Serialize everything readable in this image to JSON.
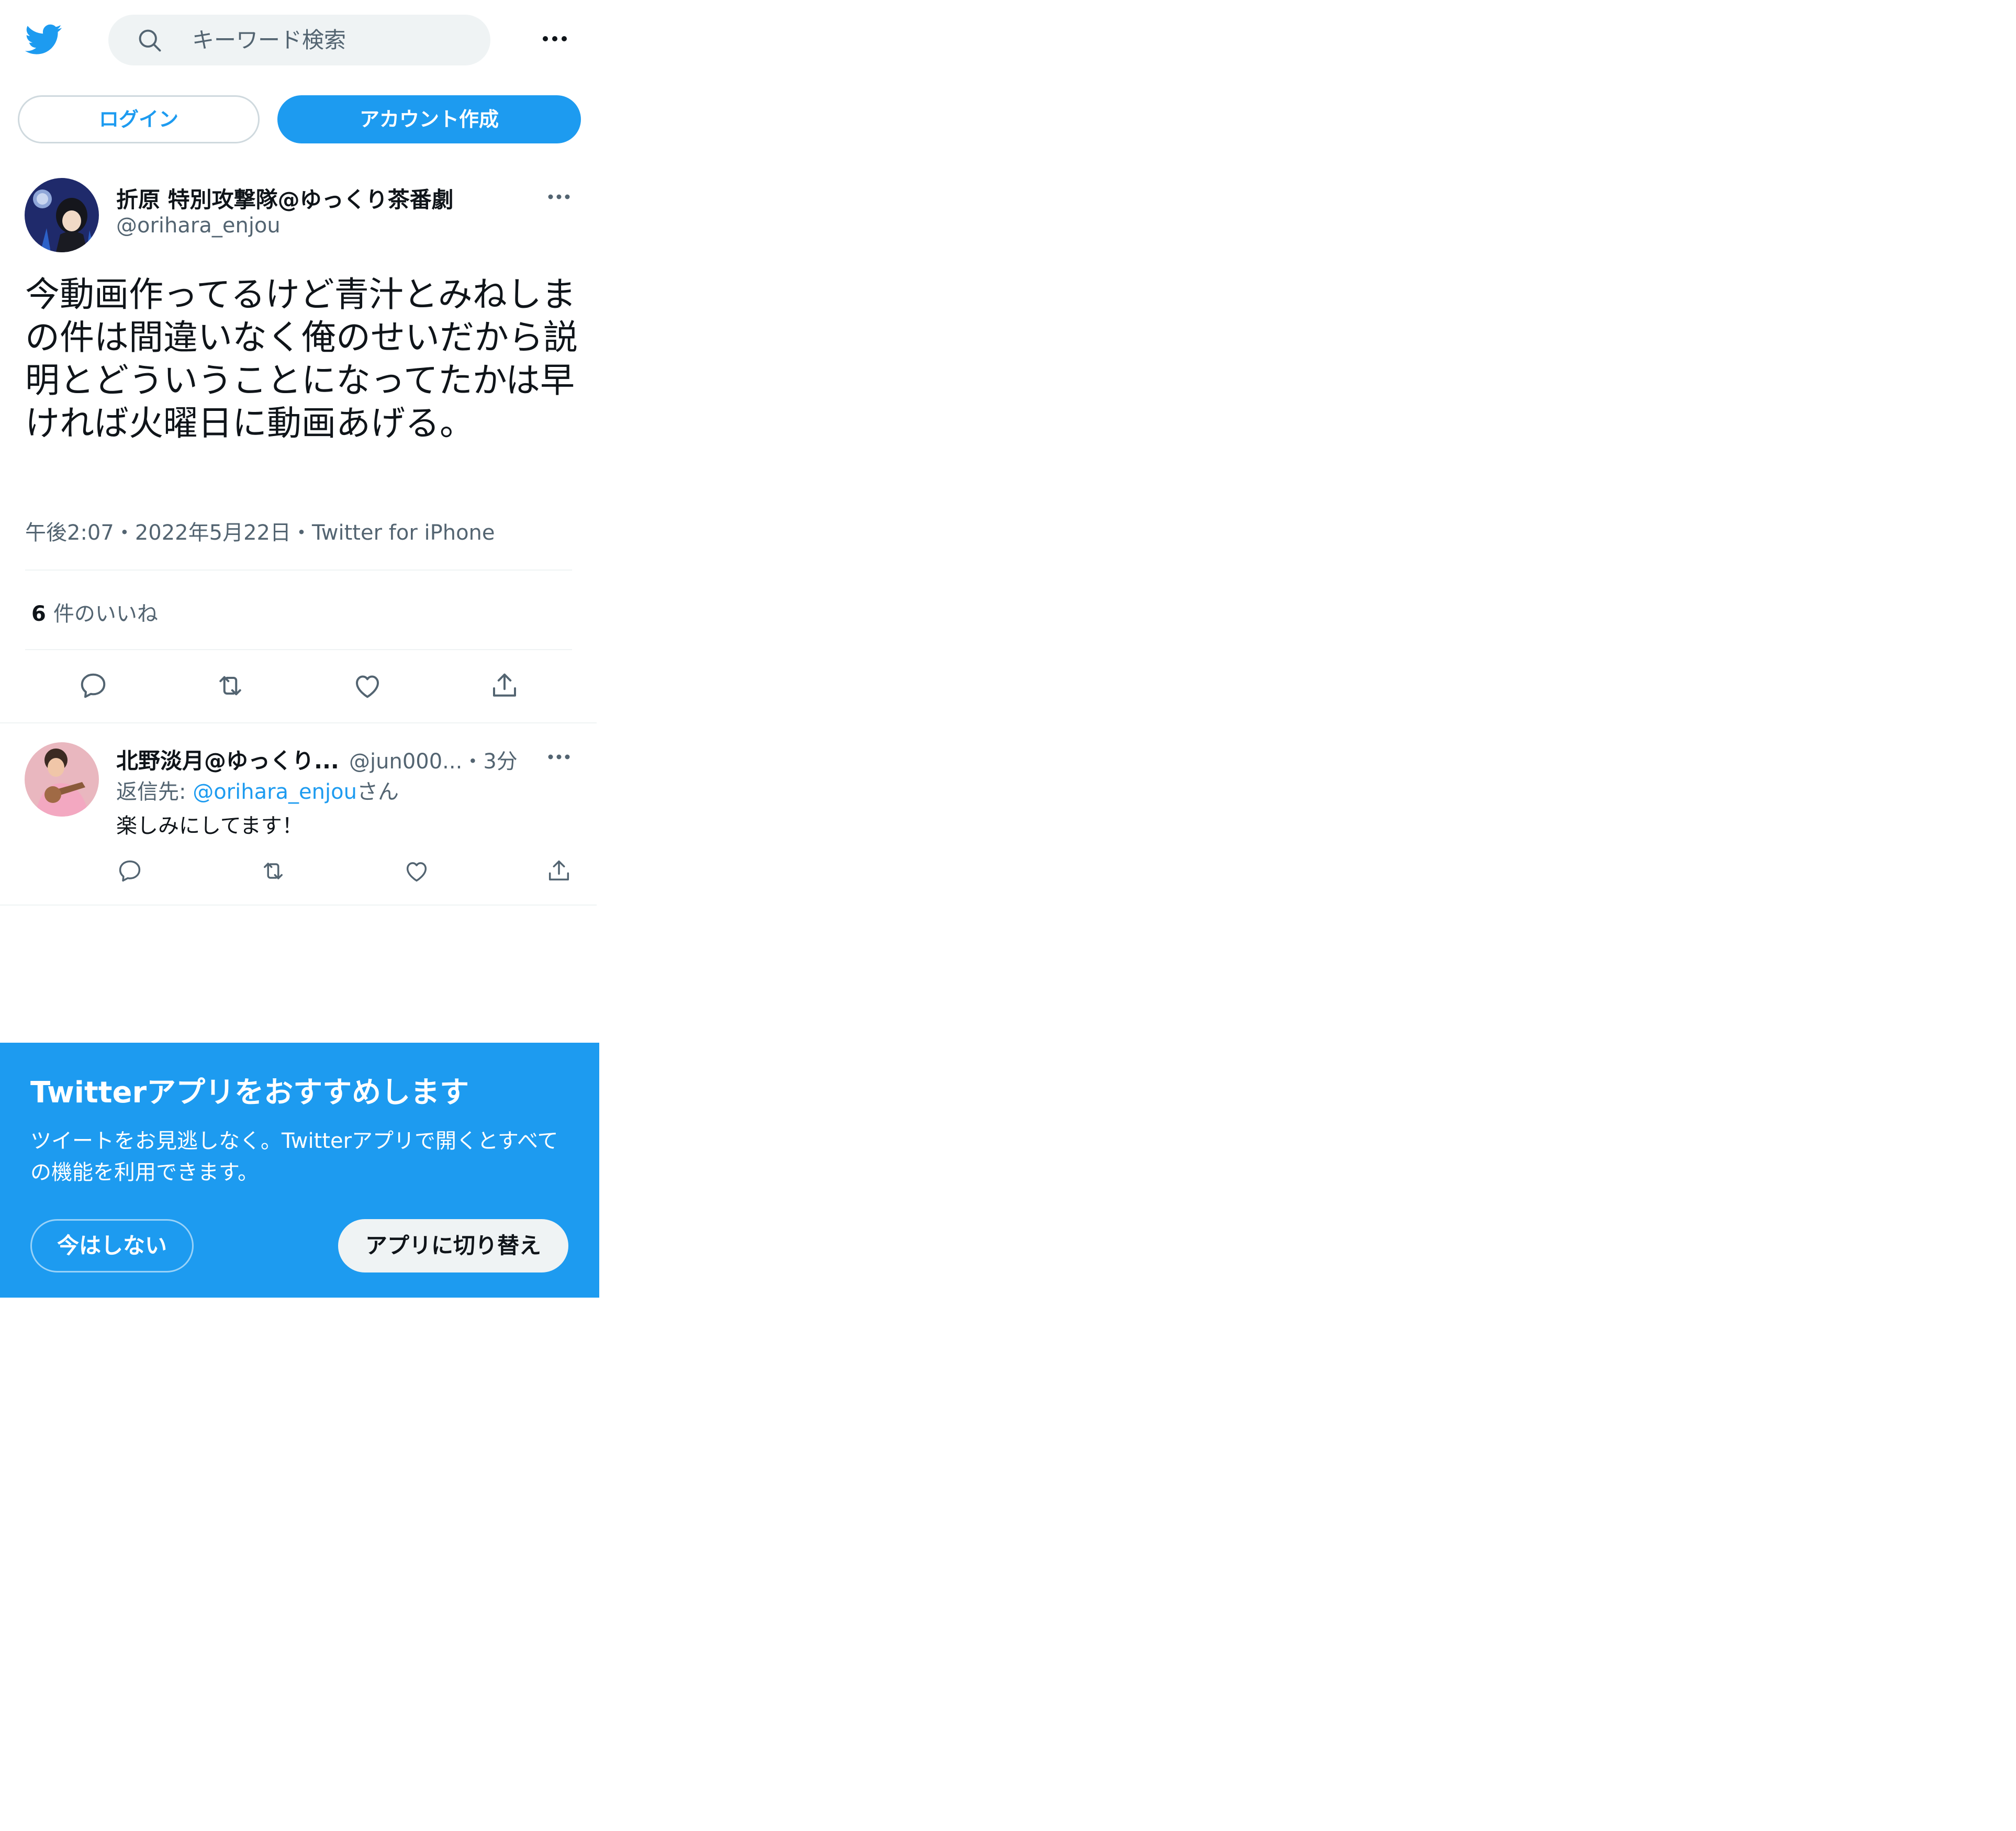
{
  "header": {
    "search_placeholder": "キーワード検索"
  },
  "auth": {
    "login_label": "ログイン",
    "signup_label": "アカウント作成"
  },
  "tweet": {
    "display_name": "折原 特別攻撃隊@ゆっくり茶番劇",
    "handle": "@orihara_enjou",
    "text": "今動画作ってるけど青汁とみねしまの件は間違いなく俺のせいだから説明とどういうことになってたかは早ければ火曜日に動画あげる。",
    "time": "午後2:07",
    "date": "2022年5月22日",
    "source": "Twitter for iPhone",
    "separator": "・",
    "likes_count": "6",
    "likes_label": "件のいいね"
  },
  "reply": {
    "display_name": "北野淡月@ゆっくり...",
    "handle": "@jun000...",
    "separator": "・",
    "time": "3分",
    "reply_to_prefix": "返信先: ",
    "reply_to_mention": "@orihara_enjou",
    "reply_to_suffix": "さん",
    "text": "楽しみにしてます！"
  },
  "banner": {
    "title": "Twitterアプリをおすすめします",
    "description": "ツイートをお見逃しなく。Twitterアプリで開くとすべての機能を利用できます。",
    "later_label": "今はしない",
    "switch_label": "アプリに切り替え"
  },
  "colors": {
    "brand": "#1d9bf0",
    "text_primary": "#0f1419",
    "text_secondary": "#536471",
    "divider": "#eff3f4"
  },
  "icons": [
    "twitter-logo-icon",
    "search-icon",
    "more-icon",
    "reply-icon",
    "retweet-icon",
    "like-icon",
    "share-icon"
  ]
}
